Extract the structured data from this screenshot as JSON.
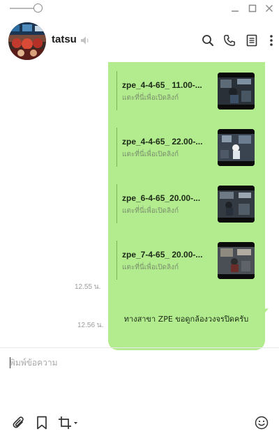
{
  "chat": {
    "name": "tatsu"
  },
  "links": [
    {
      "title": "zpe_4-4-65_ 11.00-...",
      "subtitle": "แตะที่นี่เพื่อเปิดลิงก์"
    },
    {
      "title": "zpe_4-4-65_ 22.00-...",
      "subtitle": "แตะที่นี่เพื่อเปิดลิงก์"
    },
    {
      "title": "zpe_6-4-65_20.00-...",
      "subtitle": "แตะที่นี่เพื่อเปิดลิงก์"
    },
    {
      "title": "zpe_7-4-65_ 20.00-...",
      "subtitle": "แตะที่นี่เพื่อเปิดลิงก์"
    }
  ],
  "messages": {
    "links_time": "12.55 น.",
    "text": "ทางสาขา ZPE ขอดูกล้องวงจรปิดครับ",
    "text_time": "12.56 น."
  },
  "composer": {
    "placeholder": "พิมพ์ข้อความ"
  },
  "colors": {
    "bubble": "#b2ec8f",
    "link_bar": "#7bb35b",
    "icon": "#333333"
  },
  "icons": {
    "titlebar": [
      "slider-icon",
      "minimize-icon",
      "maximize-icon",
      "close-icon"
    ],
    "header": [
      "speaker-muted-icon",
      "search-icon",
      "phone-icon",
      "notes-icon",
      "more-icon"
    ],
    "composer": [
      "paperclip-icon",
      "bookmark-icon",
      "crop-icon",
      "emoji-icon"
    ]
  }
}
